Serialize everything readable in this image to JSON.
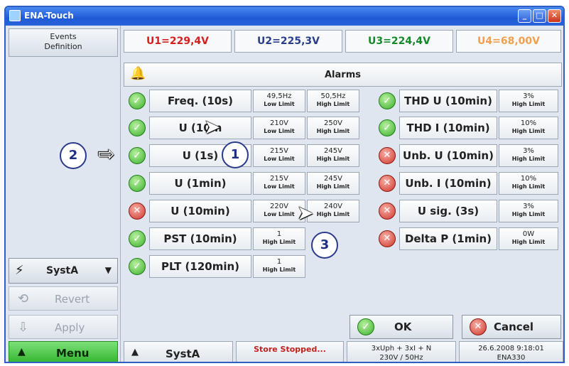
{
  "window": {
    "title": "ENA-Touch"
  },
  "left": {
    "events_label": "Events\nDefinition",
    "syst_label": "SystA",
    "revert_label": "Revert",
    "apply_label": "Apply",
    "menu_label": "Menu"
  },
  "voltages": {
    "u1": "U1=229,4V",
    "u2": "U2=225,3V",
    "u3": "U3=224,4V",
    "u4": "U4=68,00V"
  },
  "alarms": {
    "label": "Alarms"
  },
  "rows_left": [
    {
      "status": "ok",
      "name": "Freq. (10s)",
      "low": "49,5Hz",
      "low_t": "Low Limit",
      "high": "50,5Hz",
      "high_t": "High Limit"
    },
    {
      "status": "ok",
      "name": "U (10m",
      "low": "210V",
      "low_t": "Low Limit",
      "high": "250V",
      "high_t": "High Limit"
    },
    {
      "status": "ok",
      "name": "U (1s)",
      "low": "215V",
      "low_t": "Low Limit",
      "high": "245V",
      "high_t": "High Limit"
    },
    {
      "status": "ok",
      "name": "U (1min)",
      "low": "215V",
      "low_t": "Low Limit",
      "high": "245V",
      "high_t": "High Limit"
    },
    {
      "status": "alarm",
      "name": "U (10min)",
      "low": "220V",
      "low_t": "Low Limit",
      "high": "240V",
      "high_t": "High Limit"
    },
    {
      "status": "ok",
      "name": "PST (10min)",
      "single": "1",
      "single_t": "High Limit"
    },
    {
      "status": "ok",
      "name": "PLT (120min)",
      "single": "1",
      "single_t": "High Limit"
    }
  ],
  "rows_right": [
    {
      "status": "ok",
      "name": "THD U (10min)",
      "val": "3%",
      "val_t": "High Limit"
    },
    {
      "status": "ok",
      "name": "THD I (10min)",
      "val": "10%",
      "val_t": "High Limit"
    },
    {
      "status": "alarm",
      "name": "Unb. U (10min)",
      "val": "3%",
      "val_t": "High Limit"
    },
    {
      "status": "alarm",
      "name": "Unb. I (10min)",
      "val": "10%",
      "val_t": "High Limit"
    },
    {
      "status": "alarm",
      "name": "U sig. (3s)",
      "val": "3%",
      "val_t": "High Limit"
    },
    {
      "status": "alarm",
      "name": "Delta P (1min)",
      "val": "0W",
      "val_t": "High Limit"
    }
  ],
  "buttons": {
    "ok": "OK",
    "cancel": "Cancel"
  },
  "statusbar": {
    "syst": "SystA",
    "store": "Store Stopped...",
    "conn_line1": "3xUph + 3xI + N",
    "conn_line2": "230V / 50Hz",
    "date_line1": "26.6.2008 9:18:01",
    "date_line2": "ENA330"
  },
  "callouts": [
    "1",
    "2",
    "3"
  ],
  "colors": {
    "accent_title": "#2a63da",
    "u1": "#d62020",
    "u3": "#168a2a",
    "u4": "#f0a050",
    "menu": "#2fb32a"
  }
}
